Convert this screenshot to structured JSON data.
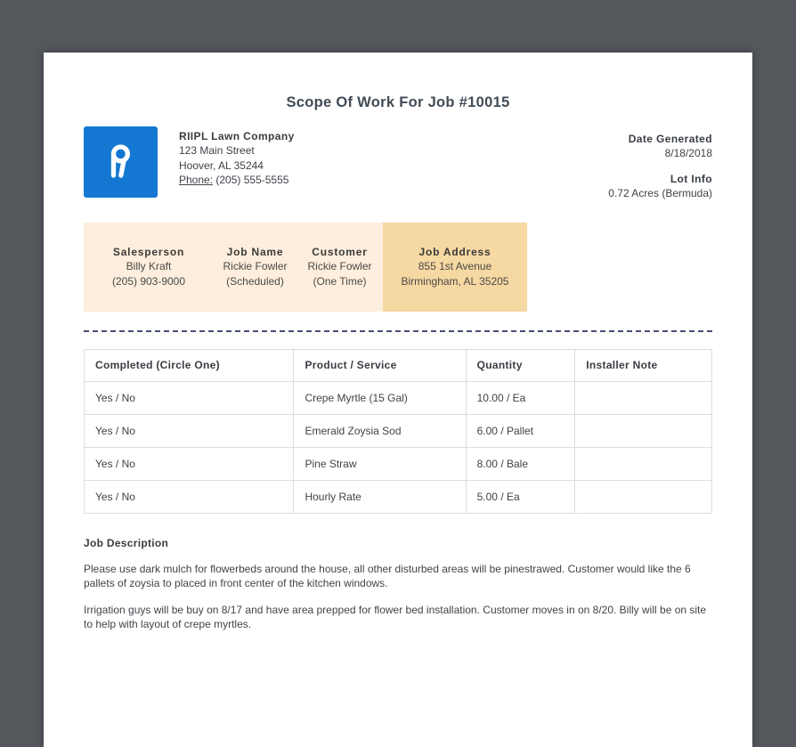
{
  "colors": {
    "bg-dark": "#54575c",
    "logo-blue": "#1478d2",
    "band-light": "#fdeedd",
    "band-highlight": "#f6d8a2",
    "dash-color": "#454e74",
    "title-color": "#414b55",
    "text-main": "#3e4249"
  },
  "doc": {
    "title": "Scope Of Work For Job #10015"
  },
  "company": {
    "logo_icon": "riipl-r-logo",
    "name": "RIIPL Lawn Company",
    "address_line1": "123 Main Street",
    "address_line2": "Hoover, AL 35244",
    "phone_label": "Phone:",
    "phone_number": "(205) 555-5555"
  },
  "meta": {
    "date_generated_label": "Date Generated",
    "date_generated": "8/18/2018",
    "lot_info_label": "Lot Info",
    "lot_info": "0.72 Acres (Bermuda)"
  },
  "job_info": {
    "cells": [
      {
        "label": "Salesperson",
        "line1": "Billy Kraft",
        "line2": "(205) 903-9000"
      },
      {
        "label": "Job Name",
        "line1": "Rickie Fowler",
        "line2": "(Scheduled)"
      },
      {
        "label": "Customer",
        "line1": "Rickie Fowler",
        "line2": "(One Time)"
      },
      {
        "label": "Job Address",
        "line1": "855 1st Avenue",
        "line2": "Birmingham, AL 35205"
      }
    ]
  },
  "work_table": {
    "headers": [
      "Completed (Circle One)",
      "Product / Service",
      "Quantity",
      "Installer Note"
    ],
    "rows": [
      {
        "completed": "Yes / No",
        "product": "Crepe Myrtle (15 Gal)",
        "quantity": "10.00 / Ea",
        "note": ""
      },
      {
        "completed": "Yes / No",
        "product": "Emerald Zoysia Sod",
        "quantity": "6.00 / Pallet",
        "note": ""
      },
      {
        "completed": "Yes / No",
        "product": "Pine Straw",
        "quantity": "8.00 / Bale",
        "note": ""
      },
      {
        "completed": "Yes / No",
        "product": "Hourly Rate",
        "quantity": "5.00 / Ea",
        "note": ""
      }
    ]
  },
  "job_description": {
    "heading": "Job Description",
    "paragraphs": [
      "Please use dark mulch for flowerbeds around the house, all other disturbed areas will be pinestrawed. Customer would like the 6 pallets of zoysia to placed in front center of the kitchen windows.",
      "Irrigation guys will be buy on 8/17 and have area prepped for flower bed installation. Customer moves in on 8/20. Billy will be on site to help with layout of crepe myrtles."
    ]
  }
}
